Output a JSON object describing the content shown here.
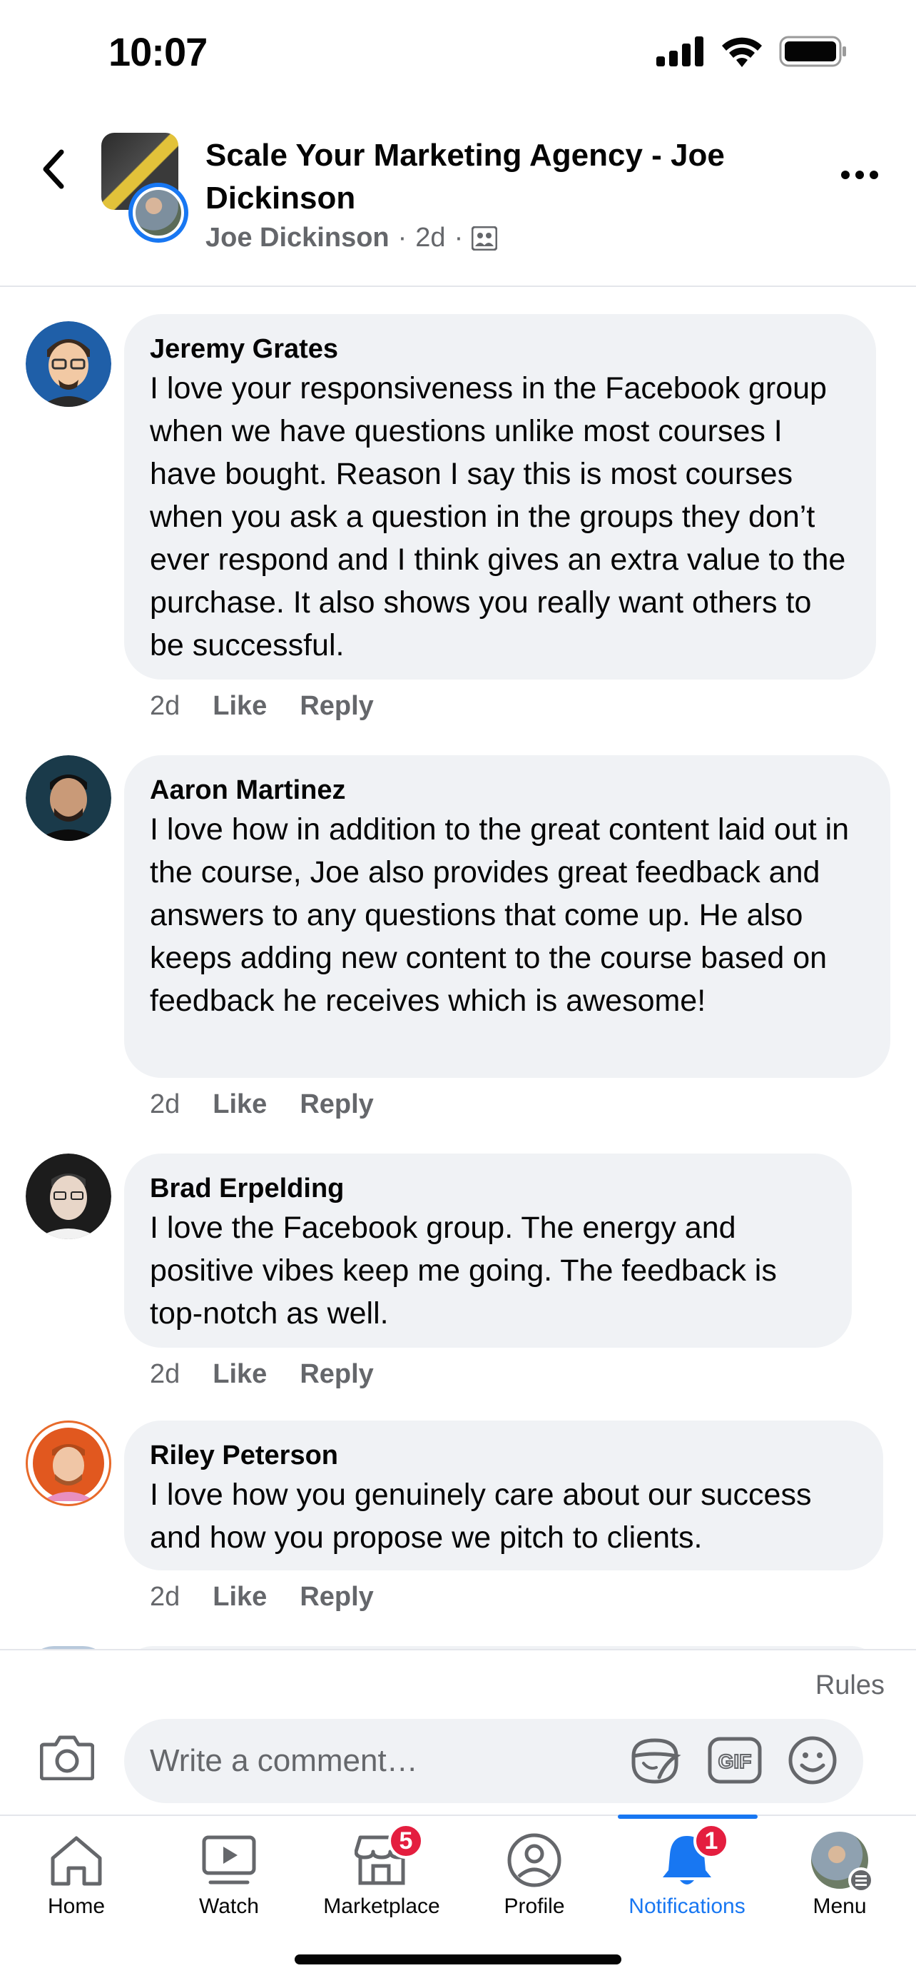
{
  "status_bar": {
    "time": "10:07"
  },
  "header": {
    "title": "Scale Your Marketing Agency - Joe Dickinson",
    "author": "Joe Dickinson",
    "age": "2d",
    "dot": "·",
    "audience_icon": "group-icon",
    "back_icon": "chevron-left-icon",
    "more_icon": "more-horizontal-icon"
  },
  "comments": [
    {
      "name": "Jeremy Grates",
      "text": "I love your responsiveness in the Facebook group when we have questions unlike most courses I have bought. Reason I say this is most courses when you ask a question in the groups they don’t ever respond and I think gives an extra value to the purchase. It also shows you really want others to be successful.",
      "age": "2d",
      "like": "Like",
      "reply": "Reply"
    },
    {
      "name": "Aaron Martinez",
      "text": "I love how in addition to the great content laid out in the course, Joe also provides great feedback and answers to any questions that come up. He also keeps adding new content to the course based on feedback he receives which is awesome!",
      "age": "2d",
      "like": "Like",
      "reply": "Reply"
    },
    {
      "name": "Brad Erpelding",
      "text": "I love the Facebook group. The energy and positive vibes keep me going. The feedback is top-notch as well.",
      "age": "2d",
      "like": "Like",
      "reply": "Reply"
    },
    {
      "name": "Riley Peterson",
      "text": "I love how you genuinely care about our success and how you propose we pitch to clients.",
      "age": "2d",
      "like": "Like",
      "reply": "Reply"
    }
  ],
  "composer": {
    "rules": "Rules",
    "placeholder": "Write a comment…",
    "icons": [
      "camera-icon",
      "sticker-icon",
      "gif-icon",
      "emoji-icon"
    ],
    "gif_label": "GIF"
  },
  "tabbar": {
    "tabs": [
      {
        "label": "Home",
        "icon": "home-icon"
      },
      {
        "label": "Watch",
        "icon": "watch-icon"
      },
      {
        "label": "Marketplace",
        "icon": "marketplace-icon",
        "badge": "5"
      },
      {
        "label": "Profile",
        "icon": "profile-icon"
      },
      {
        "label": "Notifications",
        "icon": "bell-icon",
        "badge": "1",
        "active": true
      },
      {
        "label": "Menu",
        "icon": "menu-avatar"
      }
    ]
  },
  "colors": {
    "accent": "#1877f2",
    "bubble": "#f0f2f5",
    "muted": "#65676b",
    "badge": "#e41e3f"
  }
}
